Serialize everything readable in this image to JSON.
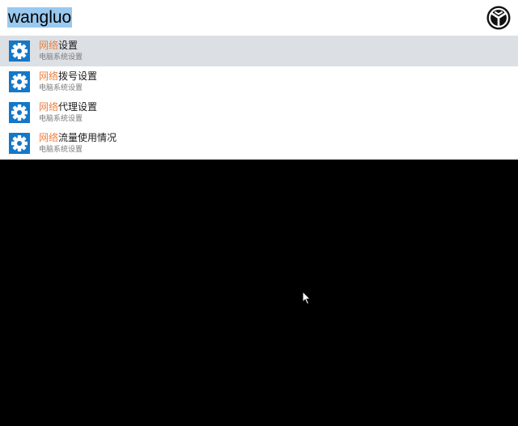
{
  "search": {
    "value": "wangluo"
  },
  "colors": {
    "highlight": "#f0803c",
    "selection": "#99c9ef",
    "selected_row": "#dcdfe3",
    "icon_tile": "#1478c8"
  },
  "results": [
    {
      "highlight": "网络",
      "rest": "设置",
      "subtitle": "电脑系统设置",
      "icon": "gear-icon"
    },
    {
      "highlight": "网络",
      "rest": "拨号设置",
      "subtitle": "电脑系统设置",
      "icon": "gear-icon"
    },
    {
      "highlight": "网络",
      "rest": "代理设置",
      "subtitle": "电脑系统设置",
      "icon": "gear-icon"
    },
    {
      "highlight": "网络",
      "rest": "流量使用情况",
      "subtitle": "电脑系统设置",
      "icon": "gear-icon"
    }
  ]
}
